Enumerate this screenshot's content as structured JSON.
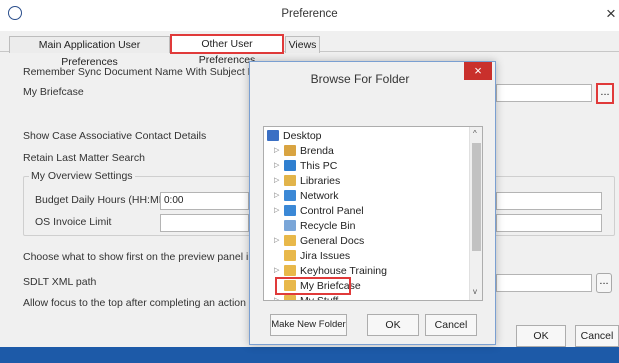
{
  "window": {
    "title": "Preference",
    "close": "×"
  },
  "tabs": [
    {
      "label": "Main Application User Preferences"
    },
    {
      "label": "Other User Preferences"
    },
    {
      "label": "Views"
    }
  ],
  "form": {
    "remember_sync_label": "Remember Sync Document Name With Subject Line",
    "my_briefcase_label": "My Briefcase",
    "browse_button": "...",
    "show_case_label": "Show Case Associative Contact Details",
    "retain_search_label": "Retain Last Matter Search",
    "overview_group": "My Overview Settings",
    "budget_label": "Budget Daily Hours (HH:MM)",
    "budget_value": "0:00",
    "invoice_label": "OS Invoice Limit",
    "preview_label": "Choose what to show first on the preview panel in the",
    "sdlt_label": "SDLT XML path",
    "focus_label": "Allow focus to the top after completing an action"
  },
  "footer": {
    "ok": "OK",
    "cancel": "Cancel"
  },
  "dialog": {
    "title": "Browse For Folder",
    "close": "×",
    "items": [
      {
        "label": "Desktop",
        "icon": "desktop-icon",
        "color": "#3a6fc4"
      },
      {
        "label": "Brenda",
        "icon": "user-folder-icon",
        "color": "#d9a441"
      },
      {
        "label": "This PC",
        "icon": "computer-icon",
        "color": "#2f7fd0"
      },
      {
        "label": "Libraries",
        "icon": "libraries-icon",
        "color": "#e2b44a"
      },
      {
        "label": "Network",
        "icon": "network-icon",
        "color": "#3b88d6"
      },
      {
        "label": "Control Panel",
        "icon": "control-panel-icon",
        "color": "#3b88d6"
      },
      {
        "label": "Recycle Bin",
        "icon": "recycle-bin-icon",
        "color": "#7aa6d8"
      },
      {
        "label": "General Docs",
        "icon": "folder-icon",
        "color": "#e8b84a"
      },
      {
        "label": "Jira Issues",
        "icon": "folder-icon",
        "color": "#e8b84a"
      },
      {
        "label": "Keyhouse Training",
        "icon": "folder-icon",
        "color": "#e8b84a"
      },
      {
        "label": "My Briefcase",
        "icon": "folder-icon",
        "color": "#e8b84a"
      },
      {
        "label": "My Stuff",
        "icon": "folder-icon",
        "color": "#e8b84a"
      }
    ],
    "make_new_folder": "Make New Folder",
    "ok": "OK",
    "cancel": "Cancel"
  }
}
